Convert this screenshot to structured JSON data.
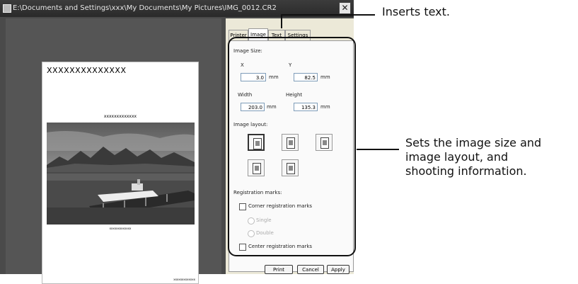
{
  "window": {
    "title": "E:\\Documents and Settings\\xxx\\My Documents\\My Pictures\\IMG_0012.CR2",
    "close_label": "✕"
  },
  "preview": {
    "page_title": "XXXXXXXXXXXXXX",
    "subtitle": "xxxxxxxxxxxxx",
    "caption": "xxxxxxxxxxxxx",
    "footer": "xxxxxxxxxxxxx"
  },
  "tabs": [
    {
      "label": "Printer",
      "active": false
    },
    {
      "label": "Image",
      "active": true
    },
    {
      "label": "Text",
      "active": false
    },
    {
      "label": "Settings",
      "active": false
    }
  ],
  "image_tab": {
    "image_size_label": "Image Size:",
    "x_label": "X",
    "y_label": "Y",
    "x_value": "3.0",
    "y_value": "82.5",
    "width_label": "Width",
    "height_label": "Height",
    "width_value": "203.0",
    "height_value": "135.3",
    "unit": "mm",
    "image_layout_label": "Image layout:",
    "registration_marks_label": "Registration marks:",
    "corner_marks_label": "Corner registration marks",
    "single_label": "Single",
    "double_label": "Double",
    "center_marks_label": "Center registration marks"
  },
  "buttons": {
    "print": "Print",
    "cancel": "Cancel",
    "apply": "Apply"
  },
  "callouts": {
    "text_tab": "Inserts text.",
    "image_tab_line1": "Sets the image size and",
    "image_tab_line2": "image layout, and",
    "image_tab_line3": "shooting information."
  }
}
